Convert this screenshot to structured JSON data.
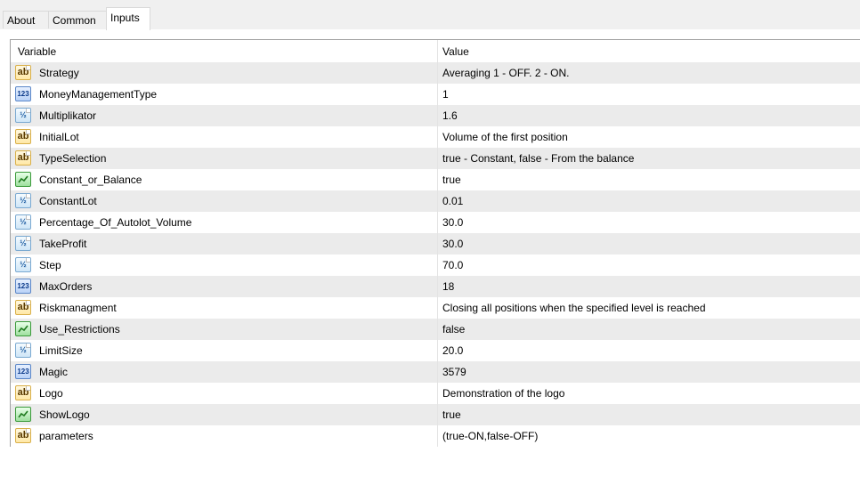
{
  "tabs": [
    "About",
    "Common",
    "Inputs"
  ],
  "active_tab": "Inputs",
  "columns": {
    "variable": "Variable",
    "value": "Value"
  },
  "icon_types": {
    "ab": "string-type-icon",
    "123": "integer-type-icon",
    "v2": "double-type-icon",
    "bool": "boolean-type-icon"
  },
  "icon_glyphs": {
    "ab": "ab",
    "123": "123",
    "v2": "½",
    "bool": ""
  },
  "rows": [
    {
      "icon": "ab",
      "variable": "Strategy",
      "value": "Averaging 1 - OFF. 2 - ON."
    },
    {
      "icon": "123",
      "variable": "MoneyManagementType",
      "value": "1"
    },
    {
      "icon": "v2",
      "variable": "Multiplikator",
      "value": "1.6"
    },
    {
      "icon": "ab",
      "variable": "InitialLot",
      "value": "Volume of the first position"
    },
    {
      "icon": "ab",
      "variable": "TypeSelection",
      "value": "true - Constant, false - From the balance"
    },
    {
      "icon": "bool",
      "variable": "Constant_or_Balance",
      "value": "true"
    },
    {
      "icon": "v2",
      "variable": "ConstantLot",
      "value": "0.01"
    },
    {
      "icon": "v2",
      "variable": "Percentage_Of_Autolot_Volume",
      "value": "30.0"
    },
    {
      "icon": "v2",
      "variable": "TakeProfit",
      "value": "30.0"
    },
    {
      "icon": "v2",
      "variable": "Step",
      "value": "70.0"
    },
    {
      "icon": "123",
      "variable": "MaxOrders",
      "value": "18"
    },
    {
      "icon": "ab",
      "variable": "Riskmanagment",
      "value": "Closing all positions when the specified level is reached"
    },
    {
      "icon": "bool",
      "variable": "Use_Restrictions",
      "value": "false"
    },
    {
      "icon": "v2",
      "variable": "LimitSize",
      "value": "20.0"
    },
    {
      "icon": "123",
      "variable": "Magic",
      "value": "3579"
    },
    {
      "icon": "ab",
      "variable": "Logo",
      "value": "Demonstration of the logo"
    },
    {
      "icon": "bool",
      "variable": "ShowLogo",
      "value": "true"
    },
    {
      "icon": "ab",
      "variable": "parameters",
      "value": "(true-ON,false-OFF)"
    }
  ]
}
